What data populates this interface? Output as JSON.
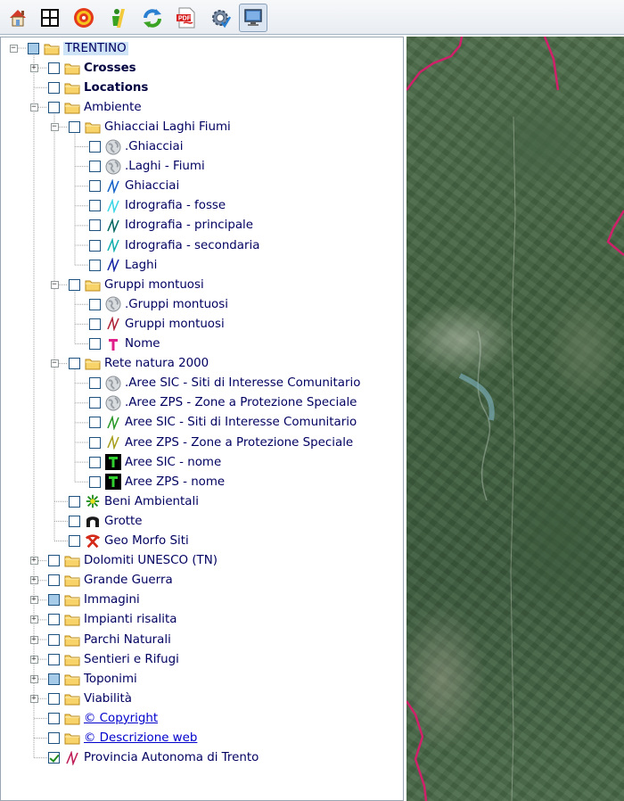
{
  "toolbar": {
    "buttons": [
      {
        "name": "home-icon"
      },
      {
        "name": "grid-icon"
      },
      {
        "name": "target-icon"
      },
      {
        "name": "info-icon"
      },
      {
        "name": "refresh-icon"
      },
      {
        "name": "pdf-icon"
      },
      {
        "name": "settings-icon"
      },
      {
        "name": "monitor-icon",
        "active": true
      }
    ]
  },
  "tree": {
    "root": {
      "label": "TRENTINO"
    },
    "items": [
      {
        "id": "crosses",
        "label": "Crosses",
        "bold": true
      },
      {
        "id": "locations",
        "label": "Locations",
        "bold": true
      },
      {
        "id": "ambiente",
        "label": "Ambiente"
      },
      {
        "id": "ghiacciai-laghi-fiumi",
        "label": "Ghiacciai Laghi Fiumi"
      },
      {
        "id": "ghiacciai-globe",
        "label": ".Ghiacciai"
      },
      {
        "id": "laghi-fiumi-globe",
        "label": ".Laghi - Fiumi"
      },
      {
        "id": "ghiacciai",
        "label": "Ghiacciai"
      },
      {
        "id": "idrografia-fosse",
        "label": "Idrografia - fosse"
      },
      {
        "id": "idrografia-principale",
        "label": "Idrografia - principale"
      },
      {
        "id": "idrografia-secondaria",
        "label": "Idrografia - secondaria"
      },
      {
        "id": "laghi",
        "label": "Laghi"
      },
      {
        "id": "gruppi-montuosi-folder",
        "label": "Gruppi montuosi"
      },
      {
        "id": "gruppi-montuosi-globe",
        "label": ".Gruppi montuosi"
      },
      {
        "id": "gruppi-montuosi",
        "label": "Gruppi montuosi"
      },
      {
        "id": "nome",
        "label": "Nome"
      },
      {
        "id": "rete-natura",
        "label": "Rete natura 2000"
      },
      {
        "id": "aree-sic-globe",
        "label": ".Aree SIC - Siti di Interesse Comunitario"
      },
      {
        "id": "aree-zps-globe",
        "label": ".Aree ZPS - Zone a Protezione Speciale"
      },
      {
        "id": "aree-sic",
        "label": "Aree SIC - Siti di Interesse Comunitario"
      },
      {
        "id": "aree-zps",
        "label": "Aree ZPS - Zone a Protezione Speciale"
      },
      {
        "id": "aree-sic-nome",
        "label": "Aree SIC - nome"
      },
      {
        "id": "aree-zps-nome",
        "label": "Aree ZPS - nome"
      },
      {
        "id": "beni-ambientali",
        "label": "Beni Ambientali"
      },
      {
        "id": "grotte",
        "label": "Grotte"
      },
      {
        "id": "geo-morfo-siti",
        "label": "Geo Morfo Siti"
      },
      {
        "id": "dolomiti-unesco",
        "label": "Dolomiti UNESCO (TN)"
      },
      {
        "id": "grande-guerra",
        "label": "Grande Guerra"
      },
      {
        "id": "immagini",
        "label": "Immagini"
      },
      {
        "id": "impianti-risalita",
        "label": "Impianti risalita"
      },
      {
        "id": "parchi-naturali",
        "label": "Parchi Naturali"
      },
      {
        "id": "sentieri-rifugi",
        "label": "Sentieri e Rifugi"
      },
      {
        "id": "toponimi",
        "label": "Toponimi"
      },
      {
        "id": "viabilita",
        "label": "Viabilità"
      },
      {
        "id": "copyright",
        "label": "© Copyright"
      },
      {
        "id": "descrizione-web",
        "label": "© Descrizione web"
      },
      {
        "id": "provincia",
        "label": "Provincia Autonoma di Trento"
      }
    ]
  },
  "colors": {
    "boundary": "#d0206a",
    "tree_text": "#000060",
    "link": "#0000cc"
  }
}
